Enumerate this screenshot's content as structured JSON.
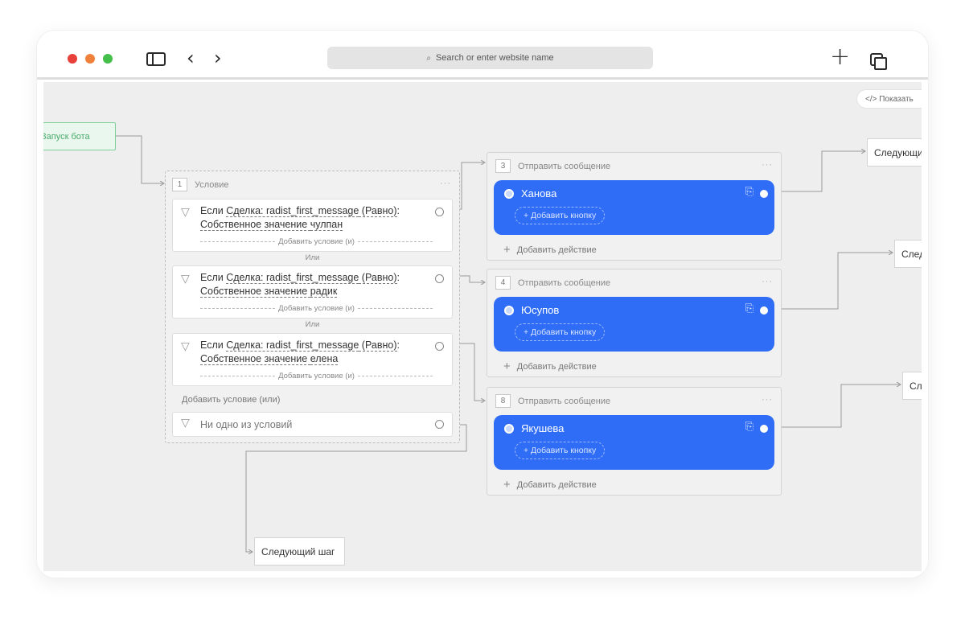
{
  "browser": {
    "address_placeholder": "Search or enter website name",
    "icons": [
      "sidebar-icon",
      "back-icon",
      "forward-icon",
      "search-icon",
      "new-tab-icon",
      "tabs-overview-icon"
    ],
    "traffic_lights": [
      "#e8413b",
      "#f0813c",
      "#44c04a"
    ]
  },
  "canvas": {
    "show_code_label": "</> Показать",
    "start_node_label": "Запуск бота",
    "condition": {
      "number": "1",
      "title": "Условие",
      "menu": "···",
      "items": [
        {
          "prefix": "Если ",
          "entity": "Сделка: radist_first_message",
          "op": " (Равно)",
          "tail": ":",
          "value_prefix": "Собственное значение ",
          "value": "чулпан",
          "add_and": "Добавить условие (и)"
        },
        {
          "prefix": "Если ",
          "entity": "Сделка: radist_first_message",
          "op": " (Равно)",
          "tail": ":",
          "value_prefix": "Собственное значение ",
          "value": "радик",
          "add_and": "Добавить условие (и)"
        },
        {
          "prefix": "Если ",
          "entity": "Сделка: radist_first_message",
          "op": " (Равно)",
          "tail": ":",
          "value_prefix": "Собственное значение ",
          "value": "елена",
          "add_and": "Добавить условие (и)"
        }
      ],
      "or_label": "Или",
      "add_or": "Добавить условие (или)",
      "none_label": "Ни одно из условий"
    },
    "messages": [
      {
        "number": "3",
        "title": "Отправить сообщение",
        "menu": "···",
        "name": "Ханова",
        "add_button": "+ Добавить кнопку",
        "add_action": "Добавить действие",
        "next": "Следующий шаг"
      },
      {
        "number": "4",
        "title": "Отправить сообщение",
        "menu": "···",
        "name": "Юсупов",
        "add_button": "+ Добавить кнопку",
        "add_action": "Добавить действие",
        "next": "Следующий шаг"
      },
      {
        "number": "8",
        "title": "Отправить сообщение",
        "menu": "···",
        "name": "Якушева",
        "add_button": "+ Добавить кнопку",
        "add_action": "Добавить действие",
        "next": "Следующий шаг"
      }
    ],
    "next_step_bottom": "Следующий шаг",
    "accent_color": "#2f6df6"
  }
}
